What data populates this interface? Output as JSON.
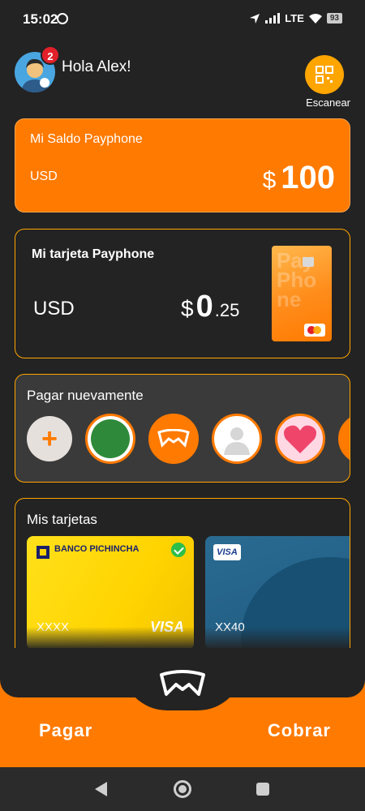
{
  "status_bar": {
    "time": "15:02",
    "network": "LTE",
    "battery": "93"
  },
  "header": {
    "greeting": "Hola Alex!",
    "notification_count": "2",
    "scan_label": "Escanear"
  },
  "saldo": {
    "title": "Mi Saldo Payphone",
    "currency": "USD",
    "symbol": "$",
    "amount": "100"
  },
  "tarjeta": {
    "title": "Mi tarjeta Payphone",
    "currency": "USD",
    "symbol": "$",
    "amount_int": "0",
    "amount_dec": ".25"
  },
  "pagar_nuevamente": {
    "title": "Pagar nuevamente",
    "add_label": "+"
  },
  "mis_tarjetas": {
    "title": "Mis tarjetas",
    "cards": [
      {
        "bank": "BANCO PICHINCHA",
        "number": "XXXX",
        "network": "VISA"
      },
      {
        "bank": "",
        "number": "XX40",
        "network": "VISA"
      }
    ]
  },
  "actions": {
    "pay": "Pagar",
    "charge": "Cobrar"
  },
  "colors": {
    "accent": "#ff7a00",
    "background": "#232323",
    "border": "#ffa500"
  }
}
